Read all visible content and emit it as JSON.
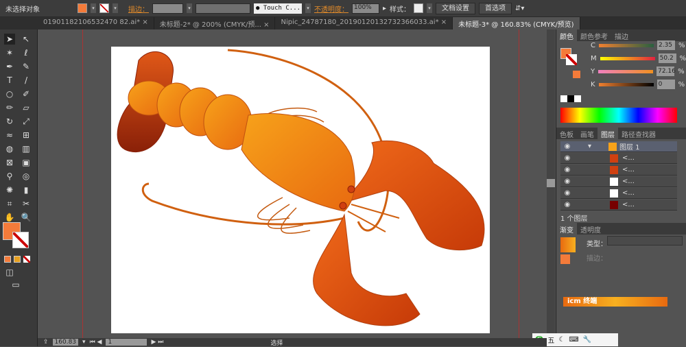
{
  "control": {
    "selection": "未选择对象",
    "stroke_label": "描边：",
    "brush": "Touch C...",
    "opacity_label": "不透明度：",
    "opacity": "100%",
    "style_label": "样式：",
    "doc_setup": "文档设置",
    "prefs": "首选项"
  },
  "tabs": [
    {
      "label": "01901182106532470 82.ai* ×"
    },
    {
      "label": "未标题-2* @ 200% (CMYK/预... ×"
    },
    {
      "label": "Nipic_24787180_20190120132732366033.ai* ×"
    },
    {
      "label": "未标题-3* @ 160.83% (CMYK/预览)"
    }
  ],
  "color_panel": {
    "tabs": [
      "颜色",
      "颜色参考",
      "描边"
    ],
    "channels": [
      {
        "name": "C",
        "value": "2.35"
      },
      {
        "name": "M",
        "value": "50.2"
      },
      {
        "name": "Y",
        "value": "72.16"
      },
      {
        "name": "K",
        "value": "0"
      }
    ],
    "unit": "%",
    "fill": "#f47b3a"
  },
  "layers_panel": {
    "tabs": [
      "色板",
      "画笔",
      "图层",
      "路径查找器"
    ],
    "layer_name": "图层 1",
    "items": [
      "<...",
      "<...",
      "<...",
      "<...",
      "<..."
    ],
    "count": "1 个图层"
  },
  "gradient_panel": {
    "tabs": [
      "渐变",
      "透明度"
    ],
    "type_label": "类型：",
    "stroke_label": "描边："
  },
  "watermark": "icm 终端",
  "status": {
    "zoom": "160.83",
    "page": "1",
    "tool": "选择"
  },
  "ime": "五"
}
